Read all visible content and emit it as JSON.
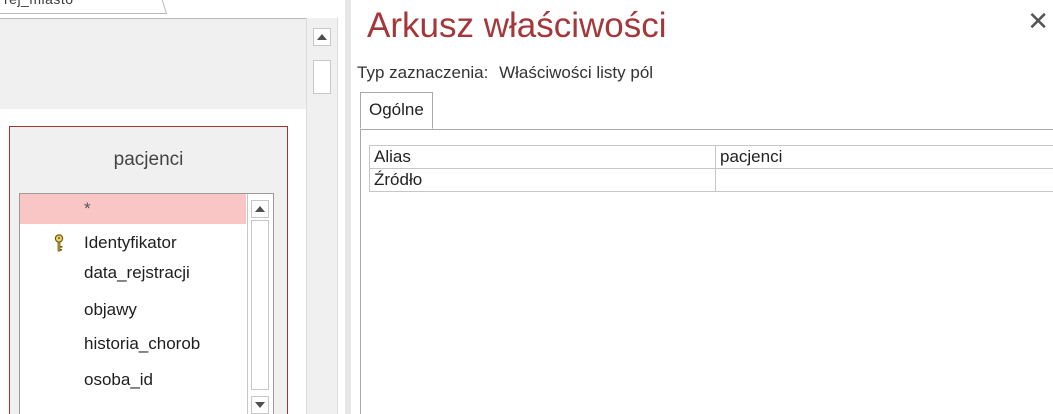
{
  "design": {
    "tab_label": "rej_miasto",
    "table": {
      "title": "pacjenci",
      "fields": [
        {
          "label": "*",
          "selected": true,
          "key": false
        },
        {
          "label": "Identyfikator",
          "selected": false,
          "key": true
        },
        {
          "label": "data_rejstracji",
          "selected": false,
          "key": false
        },
        {
          "label": "objawy",
          "selected": false,
          "key": false
        },
        {
          "label": "historia_chorob",
          "selected": false,
          "key": false
        },
        {
          "label": "osoba_id",
          "selected": false,
          "key": false
        }
      ]
    }
  },
  "property_sheet": {
    "title": "Arkusz właściwości",
    "close_icon": "close-icon",
    "selection_type_label": "Typ zaznaczenia:",
    "selection_type_value": "Właściwości listy pól",
    "tabs": [
      {
        "label": "Ogólne",
        "active": true
      }
    ],
    "properties": [
      {
        "name": "Alias",
        "value": "pacjenci"
      },
      {
        "name": "Źródło",
        "value": ""
      }
    ],
    "accent_color": "#a4373a"
  },
  "colors": {
    "selected_field_bg": "#f9c5c5",
    "table_border": "#a23434"
  }
}
